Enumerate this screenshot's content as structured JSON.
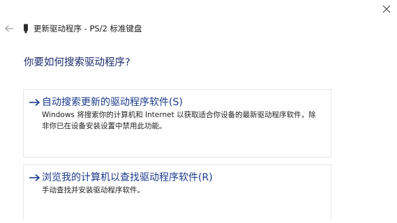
{
  "window": {
    "title": "更新驱动程序 - PS/2 标准键盘"
  },
  "heading": "你要如何搜索驱动程序?",
  "options": [
    {
      "title": "自动搜索更新的驱动程序软件(S)",
      "description": "Windows 将搜索你的计算机和 Internet 以获取适合你设备的最新驱动程序软件，除非你已在设备安装设置中禁用此功能。"
    },
    {
      "title": "浏览我的计算机以查找驱动程序软件(R)",
      "description": "手动查找并安装驱动程序软件。"
    }
  ],
  "icons": {
    "close": "close-icon",
    "back": "back-arrow-icon",
    "device": "device-icon",
    "option_arrow": "right-arrow-icon"
  },
  "colors": {
    "heading": "#1e2b6e",
    "option_title": "#1b3a8c",
    "arrow": "#1b3a8c"
  }
}
